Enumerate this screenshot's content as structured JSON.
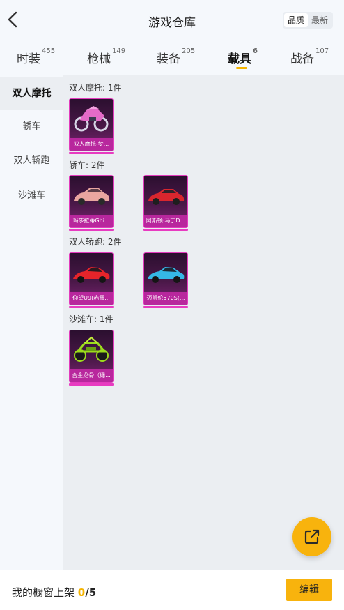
{
  "header": {
    "title": "游戏仓库",
    "sort_options": [
      "品质",
      "最新"
    ]
  },
  "tabs": [
    {
      "label": "时装",
      "count": "455"
    },
    {
      "label": "枪械",
      "count": "149"
    },
    {
      "label": "装备",
      "count": "205"
    },
    {
      "label": "载具",
      "count": "6"
    },
    {
      "label": "战备",
      "count": "107"
    }
  ],
  "sidebar": {
    "items": [
      "双人摩托",
      "轿车",
      "双人轿跑",
      "沙滩车"
    ]
  },
  "sections": [
    {
      "label": "双人摩托: 1件",
      "items": [
        {
          "name": "双人摩托-梦..."
        }
      ]
    },
    {
      "label": "轿车: 2件",
      "items": [
        {
          "name": "玛莎拉蒂Ghi..."
        },
        {
          "name": "阿斯顿·马丁D..."
        }
      ]
    },
    {
      "label": "双人轿跑: 2件",
      "items": [
        {
          "name": "仰望U9(赤霞..."
        },
        {
          "name": "迈凯伦570S(..."
        }
      ]
    },
    {
      "label": "沙滩车: 1件",
      "items": [
        {
          "name": "合金龙骨（绿..."
        }
      ]
    }
  ],
  "bottom": {
    "prefix": "我的橱窗上架",
    "count": "0",
    "total": "/5",
    "edit_label": "编辑"
  },
  "colors": {
    "accent": "#f8b30d",
    "card_border": "#e23bbd",
    "card_label_bg": "#b8279d"
  },
  "icons": [
    "back-icon",
    "share-icon"
  ]
}
